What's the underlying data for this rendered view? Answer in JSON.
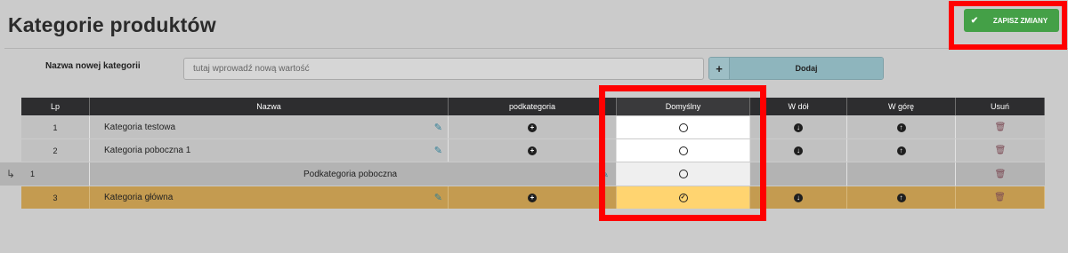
{
  "page": {
    "title": "Kategorie produktów"
  },
  "toolbar": {
    "save_label": "ZAPISZ ZMIANY",
    "save_icon": "check-icon"
  },
  "new_category": {
    "label": "Nazwa nowej kategorii",
    "placeholder": "tutaj wprowadź nową wartość",
    "value": "",
    "add_icon": "+",
    "add_label": "Dodaj"
  },
  "table": {
    "headers": {
      "lp": "Lp",
      "name": "Nazwa",
      "sub": "podkategoria",
      "default": "Domyślny",
      "down": "W dół",
      "up": "W górę",
      "delete": "Usuń"
    },
    "rows": [
      {
        "lp": "1",
        "name": "Kategoria testowa",
        "default": false
      },
      {
        "lp": "2",
        "name": "Kategoria poboczna 1",
        "default": false
      },
      {
        "lp": "1",
        "name": "Podkategoria poboczna",
        "default": false,
        "child": true
      },
      {
        "lp": "3",
        "name": "Kategoria główna",
        "default": true
      }
    ]
  },
  "colors": {
    "save_green": "#44a047",
    "highlight_red": "#ff0000",
    "header_dark": "#2d2d2f",
    "selected_row": "#c49b50",
    "selected_default": "#ffd470",
    "add_button": "#8eb5bd"
  }
}
